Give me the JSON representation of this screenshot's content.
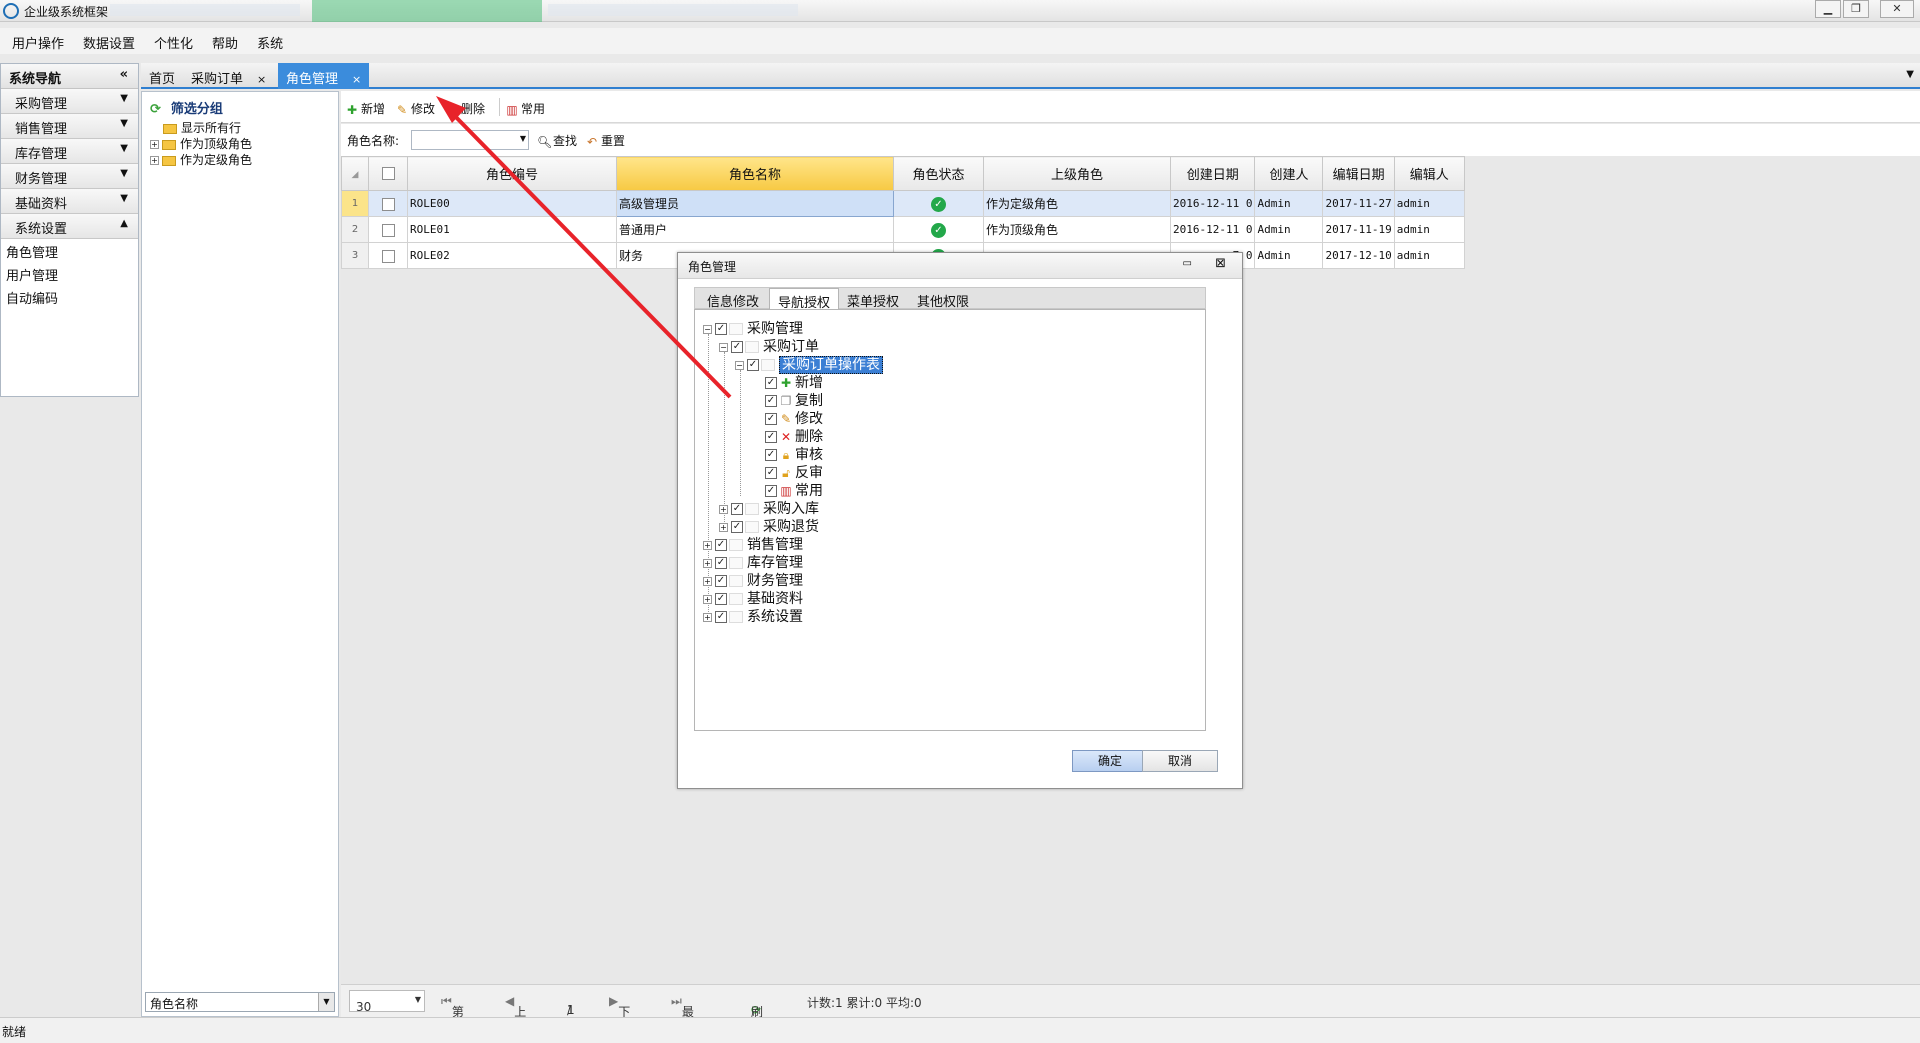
{
  "window": {
    "title": "企业级系统框架"
  },
  "menu": [
    "用户操作",
    "数据设置",
    "个性化",
    "帮助",
    "系统"
  ],
  "nav": {
    "header": "系统导航",
    "collapse": "«",
    "groups": [
      "采购管理",
      "销售管理",
      "库存管理",
      "财务管理",
      "基础资料",
      "系统设置"
    ],
    "items": [
      "角色管理",
      "用户管理",
      "自动编码"
    ]
  },
  "tabs": [
    {
      "label": "首页"
    },
    {
      "label": "采购订单",
      "close": "×"
    },
    {
      "label": "角色管理",
      "close": "×"
    }
  ],
  "filter": {
    "title": "筛选分组",
    "tree": [
      "显示所有行",
      "作为顶级角色",
      "作为定级角色"
    ],
    "footer_value": "角色名称"
  },
  "toolbar": {
    "add": "新增",
    "edit": "修改",
    "delete": "删除",
    "common": "常用"
  },
  "search": {
    "label": "角色名称:",
    "search_btn": "查找",
    "reset_btn": "重置"
  },
  "grid": {
    "columns": [
      "角色编号",
      "角色名称",
      "角色状态",
      "上级角色",
      "创建日期",
      "创建人",
      "编辑日期",
      "编辑人"
    ],
    "rows": [
      {
        "no": "1",
        "code": "ROLE00",
        "name": "高级管理员",
        "parent": "作为定级角色",
        "created": "2016-12-11 0",
        "creator": "Admin",
        "edited": "2017-11-27",
        "editor": "admin"
      },
      {
        "no": "2",
        "code": "ROLE01",
        "name": "普通用户",
        "parent": "作为顶级角色",
        "created": "2016-12-11 0",
        "creator": "Admin",
        "edited": "2017-11-19",
        "editor": "admin"
      },
      {
        "no": "3",
        "code": "ROLE02",
        "name": "财务",
        "parent": "",
        "created": "7 0",
        "creator": "Admin",
        "edited": "2017-12-10",
        "editor": "admin"
      }
    ]
  },
  "pager": {
    "page_size": "30",
    "first": "第一页",
    "prev": "上一页",
    "page": "1",
    "sep": "/",
    "total_pages": "1",
    "next": "下一页",
    "last": "最后一页",
    "refresh": "刷新",
    "stats": "计数:1 累计:0 平均:0"
  },
  "status": "就绪",
  "dialog": {
    "title": "角色管理",
    "tabs": [
      "信息修改",
      "导航授权",
      "菜单授权",
      "其他权限"
    ],
    "active_tab": "导航授权",
    "tree": {
      "root1": "采购管理",
      "child1": "采购订单",
      "child1_1": "采购订单操作表",
      "ops": [
        "新增",
        "复制",
        "修改",
        "删除",
        "审核",
        "反审",
        "常用"
      ],
      "child2": "采购入库",
      "child3": "采购退货",
      "roots": [
        "销售管理",
        "库存管理",
        "财务管理",
        "基础资料",
        "系统设置"
      ]
    },
    "ok": "确定",
    "cancel": "取消"
  },
  "colors": {
    "accent": "#3b8cdc",
    "sorted_header": "#f7c943",
    "arrow": "#e8232a",
    "status_ok": "#23a84a"
  }
}
